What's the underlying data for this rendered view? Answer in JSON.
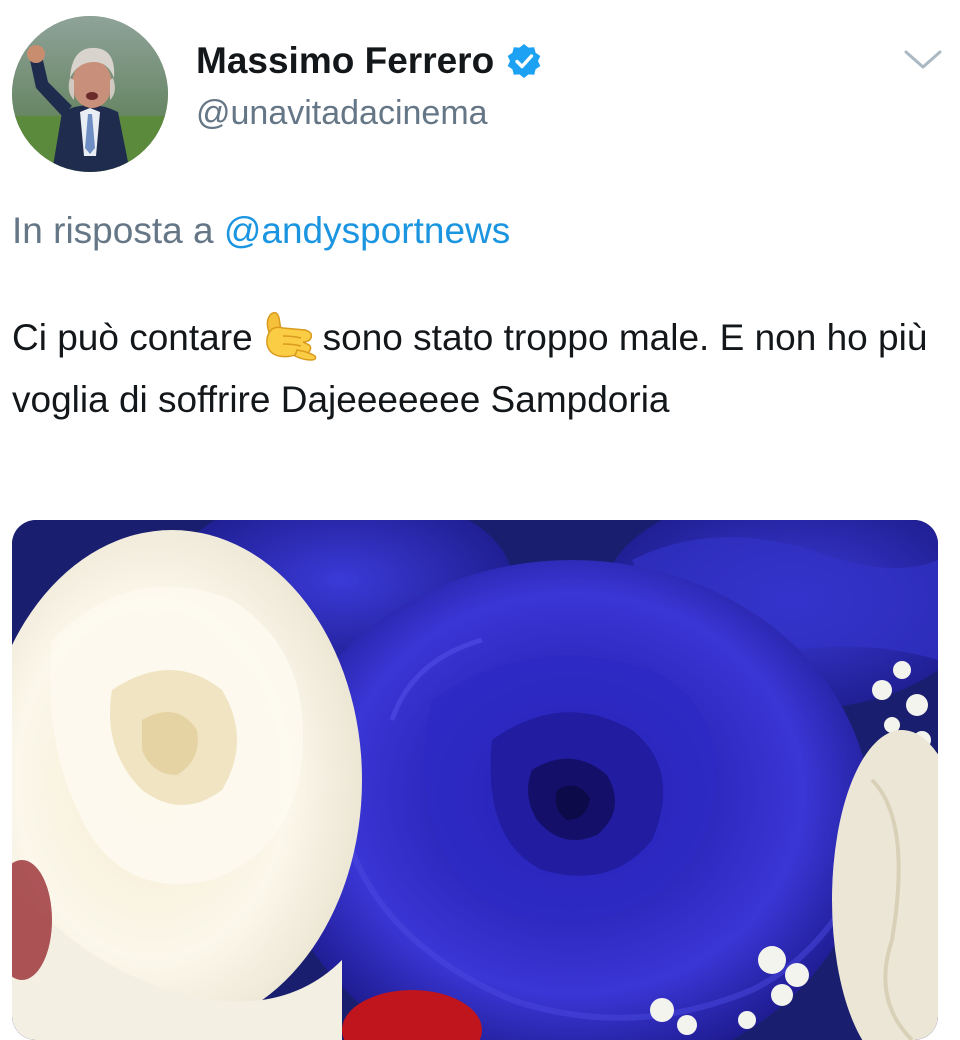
{
  "tweet": {
    "author_name": "Massimo Ferrero",
    "handle": "@unavitadacinema",
    "reply_prefix": "In risposta a",
    "reply_to": "@andysportnews",
    "text_before_emoji": "Ci può contare",
    "emoji": "call-me-hand-emoji",
    "text_after_emoji": "sono stato troppo male. E non ho più voglia di soffrire Dajeeeeeee Sampdoria",
    "verified": true,
    "media": "rose-bouquet-photo"
  },
  "colors": {
    "text": "#14171a",
    "secondary": "#657786",
    "link": "#1b95e0",
    "verified_badge": "#1da1f2",
    "caret": "#aab8c2"
  }
}
